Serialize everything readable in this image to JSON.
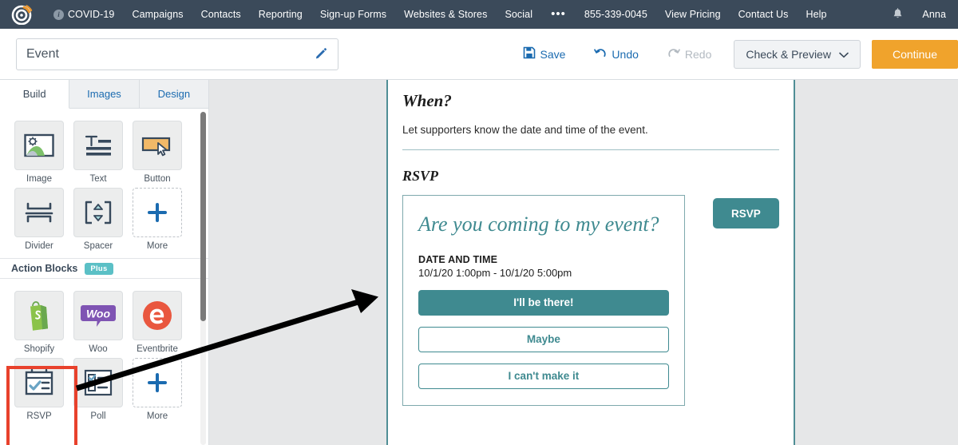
{
  "topnav": {
    "logo_icon": "constant-contact-logo-icon",
    "items": [
      {
        "label": "COVID-19",
        "icon": "info-icon"
      },
      {
        "label": "Campaigns"
      },
      {
        "label": "Contacts"
      },
      {
        "label": "Reporting"
      },
      {
        "label": "Sign-up Forms"
      },
      {
        "label": "Websites & Stores"
      },
      {
        "label": "Social"
      }
    ],
    "overflow": "•••",
    "right_items": [
      {
        "label": "855-339-0045"
      },
      {
        "label": "View Pricing"
      },
      {
        "label": "Contact Us"
      },
      {
        "label": "Help"
      }
    ],
    "bell_icon": "notification-bell-icon",
    "user": "Anna",
    "bg_color": "#3b4a5a"
  },
  "toolbar": {
    "campaign_title": "Event",
    "edit_icon": "pencil-icon",
    "save_label": "Save",
    "undo_label": "Undo",
    "redo_label": "Redo",
    "check_preview_label": "Check & Preview",
    "continue_label": "Continue",
    "link_color": "#1b6bb0",
    "continue_color": "#f0a32c"
  },
  "sidebar": {
    "tabs": [
      {
        "label": "Build",
        "active": true
      },
      {
        "label": "Images",
        "active": false
      },
      {
        "label": "Design",
        "active": false
      }
    ],
    "basic_blocks": [
      {
        "label": "Image",
        "icon": "image-block-icon"
      },
      {
        "label": "Text",
        "icon": "text-block-icon"
      },
      {
        "label": "Button",
        "icon": "button-block-icon"
      },
      {
        "label": "Divider",
        "icon": "divider-block-icon"
      },
      {
        "label": "Spacer",
        "icon": "spacer-block-icon"
      },
      {
        "label": "More",
        "icon": "plus-icon"
      }
    ],
    "action_section": {
      "title": "Action Blocks",
      "badge": "Plus",
      "badge_color": "#5bc0c6"
    },
    "action_blocks": [
      {
        "label": "Shopify",
        "icon": "shopify-icon"
      },
      {
        "label": "Woo",
        "icon": "woocommerce-icon"
      },
      {
        "label": "Eventbrite",
        "icon": "eventbrite-icon"
      },
      {
        "label": "RSVP",
        "icon": "rsvp-calendar-icon"
      },
      {
        "label": "Poll",
        "icon": "poll-icon"
      },
      {
        "label": "More",
        "icon": "plus-icon"
      }
    ],
    "highlight_color": "#e8412c"
  },
  "canvas": {
    "when_title": "When?",
    "when_subtitle": "Let supporters know the date and time of the event.",
    "rsvp_section_title": "RSVP",
    "rsvp_card": {
      "question": "Are you coming to my event?",
      "date_label": "DATE AND TIME",
      "date_value": "10/1/20 1:00pm - 10/1/20 5:00pm",
      "options": [
        {
          "label": "I'll be there!",
          "style": "filled"
        },
        {
          "label": "Maybe",
          "style": "outline"
        },
        {
          "label": "I can't make it",
          "style": "outline"
        }
      ]
    },
    "rsvp_cta_label": "RSVP",
    "accent_color": "#3f8a90"
  },
  "annotation": {
    "arrow_icon": "pointer-arrow-icon",
    "arrow_color": "#000000"
  }
}
